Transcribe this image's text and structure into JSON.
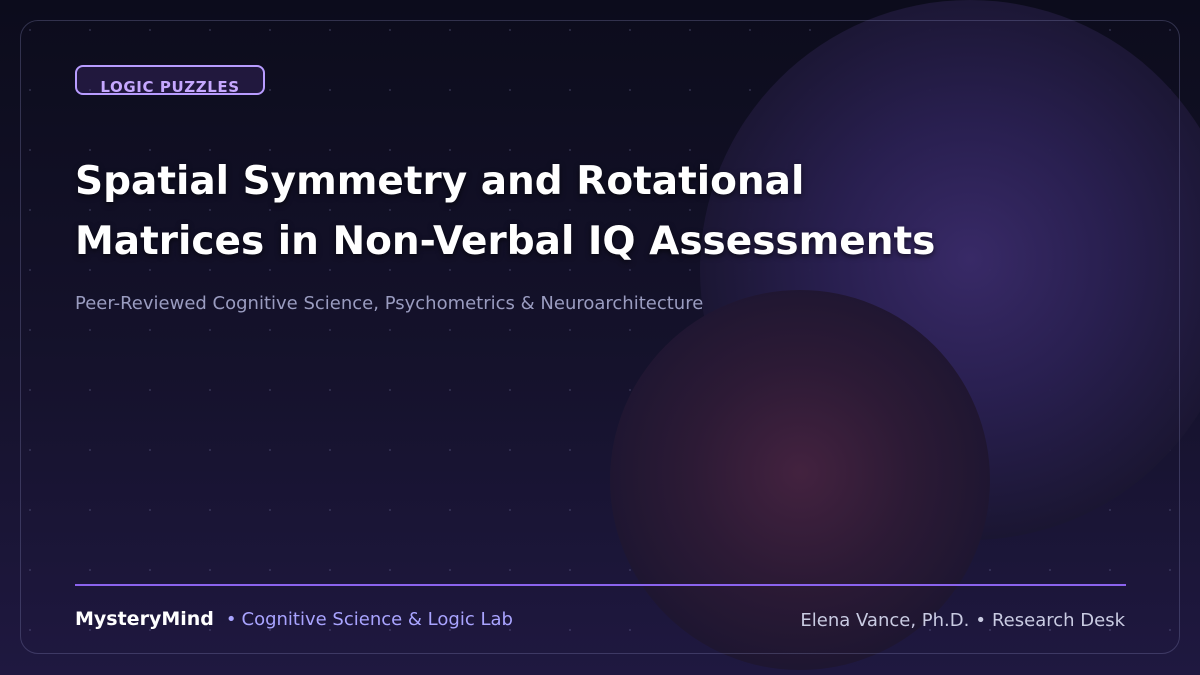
{
  "tag": {
    "label": "LOGIC PUZZLES"
  },
  "headline": {
    "line1": "Spatial Symmetry and Rotational",
    "line2": "Matrices in Non-Verbal IQ Assessments"
  },
  "subtitle": "Peer-Reviewed Cognitive Science, Psychometrics & Neuroarchitecture",
  "footer": {
    "brand": "MysteryMind",
    "separator": "•",
    "lab": "Cognitive Science & Logic Lab",
    "author": "Elena Vance, Ph.D.",
    "desk": "Research Desk"
  },
  "colors": {
    "accent": "#8b63ee",
    "tag_text": "#c6a8ff",
    "background": "#0c0c1c"
  }
}
